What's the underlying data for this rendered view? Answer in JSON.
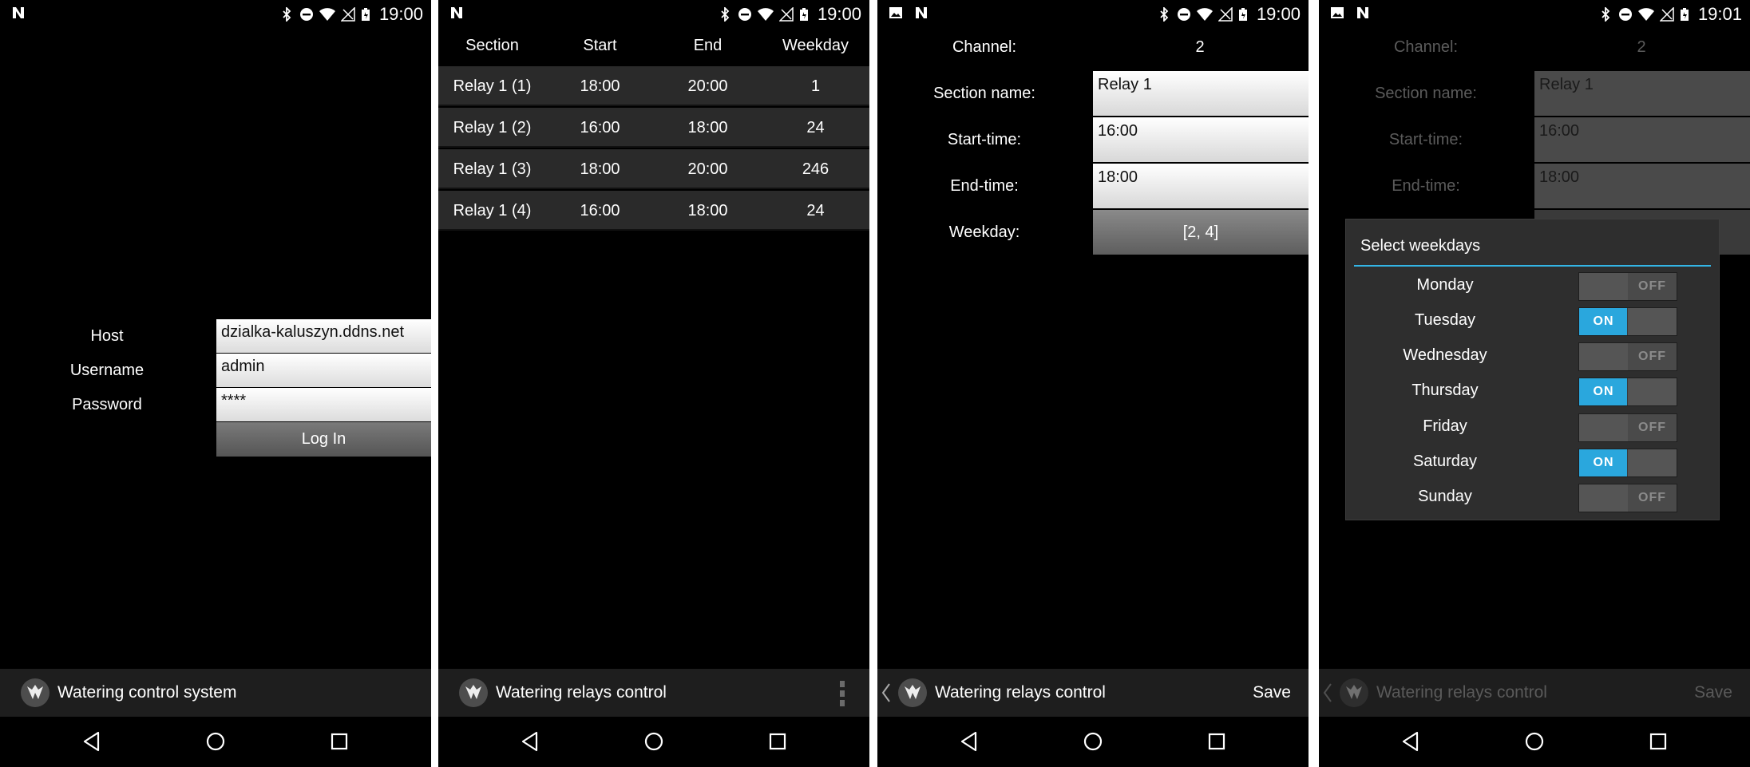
{
  "status_bar": {
    "p1": {
      "time": "19:00"
    },
    "p2": {
      "time": "19:00"
    },
    "p3": {
      "time": "19:00"
    },
    "p4": {
      "time": "19:01"
    }
  },
  "login": {
    "host_label": "Host",
    "host_value": "dzialka-kaluszyn.ddns.net",
    "username_label": "Username",
    "username_value": "admin",
    "password_label": "Password",
    "password_value": "****",
    "login_button": "Log In",
    "app_title": "Watering control system"
  },
  "relays": {
    "app_title": "Watering relays control",
    "columns": [
      "Section",
      "Start",
      "End",
      "Weekday"
    ],
    "rows": [
      {
        "section": "Relay 1 (1)",
        "start": "18:00",
        "end": "20:00",
        "weekday": "1"
      },
      {
        "section": "Relay 1 (2)",
        "start": "16:00",
        "end": "18:00",
        "weekday": "24"
      },
      {
        "section": "Relay 1 (3)",
        "start": "18:00",
        "end": "20:00",
        "weekday": "246"
      },
      {
        "section": "Relay 1 (4)",
        "start": "16:00",
        "end": "18:00",
        "weekday": "24"
      }
    ]
  },
  "edit": {
    "app_title": "Watering relays control",
    "save_label": "Save",
    "channel_label": "Channel:",
    "channel_value": "2",
    "section_name_label": "Section name:",
    "section_name_value": "Relay 1",
    "start_time_label": "Start-time:",
    "start_time_value": "16:00",
    "end_time_label": "End-time:",
    "end_time_value": "18:00",
    "weekday_label": "Weekday:",
    "weekday_value": "[2, 4]"
  },
  "weekday_popup": {
    "title": "Select weekdays",
    "on_label": "ON",
    "off_label": "OFF",
    "days": [
      {
        "name": "Monday",
        "on": false
      },
      {
        "name": "Tuesday",
        "on": true
      },
      {
        "name": "Wednesday",
        "on": false
      },
      {
        "name": "Thursday",
        "on": true
      },
      {
        "name": "Friday",
        "on": false
      },
      {
        "name": "Saturday",
        "on": true
      },
      {
        "name": "Sunday",
        "on": false
      }
    ]
  },
  "colors": {
    "accent": "#33b5e5",
    "switch_on": "#2aa7dd",
    "action_bar": "#1e1e1e",
    "row_bg": "#2a2a2a"
  }
}
